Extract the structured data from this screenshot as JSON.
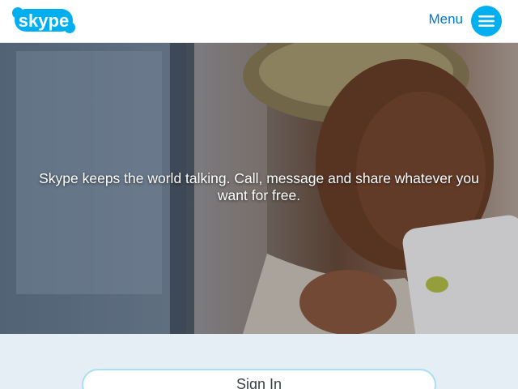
{
  "header": {
    "logo_text": "skype",
    "menu_label": "Menu"
  },
  "hero": {
    "tagline": "Skype keeps the world talking. Call, message and share whatever you want for free."
  },
  "signin": {
    "label": "Sign In"
  },
  "colors": {
    "brand_blue": "#00aff0",
    "menu_text": "#0078ca",
    "lower_background": "#e6eef5"
  },
  "icons": {
    "menu": "hamburger-icon"
  }
}
